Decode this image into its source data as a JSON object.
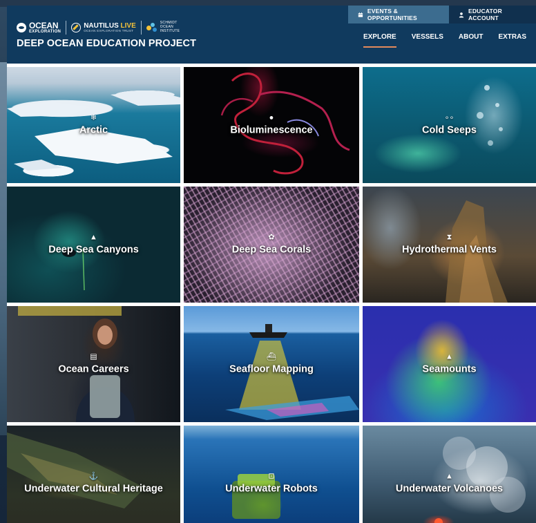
{
  "header": {
    "logos": {
      "ocean_top": "OCEAN",
      "ocean_bottom": "EXPLORATION",
      "nautilus": "NAUTILUS",
      "nautilus_live": "LIVE",
      "nautilus_sub": "OCEAN EXPLORATION TRUST",
      "schmidt_line1": "SCHMIDT",
      "schmidt_line2": "OCEAN",
      "schmidt_line3": "INSTITUTE"
    },
    "site_title": "DEEP OCEAN EDUCATION PROJECT",
    "top_buttons": {
      "events_icon": "calendar-icon",
      "events": "EVENTS & OPPORTUNITIES",
      "educator_icon": "user-icon",
      "educator": "EDUCATOR ACCOUNT"
    },
    "nav": [
      {
        "label": "EXPLORE",
        "active": true
      },
      {
        "label": "VESSELS",
        "active": false
      },
      {
        "label": "ABOUT",
        "active": false
      },
      {
        "label": "EXTRAS",
        "active": false
      }
    ]
  },
  "tiles": [
    {
      "label": "Arctic",
      "icon": "snowflake-icon"
    },
    {
      "label": "Bioluminescence",
      "icon": "lightbulb-icon"
    },
    {
      "label": "Cold Seeps",
      "icon": "bubbles-icon"
    },
    {
      "label": "Deep Sea Canyons",
      "icon": "mountains-icon"
    },
    {
      "label": "Deep Sea Corals",
      "icon": "coral-icon"
    },
    {
      "label": "Hydrothermal Vents",
      "icon": "hourglass-icon"
    },
    {
      "label": "Ocean Careers",
      "icon": "clipboard-icon"
    },
    {
      "label": "Seafloor Mapping",
      "icon": "ship-icon"
    },
    {
      "label": "Seamounts",
      "icon": "mountain-icon"
    },
    {
      "label": "Underwater Cultural Heritage",
      "icon": "anchor-icon"
    },
    {
      "label": "Underwater Robots",
      "icon": "robot-icon"
    },
    {
      "label": "Underwater Volcanoes",
      "icon": "volcano-icon"
    }
  ]
}
